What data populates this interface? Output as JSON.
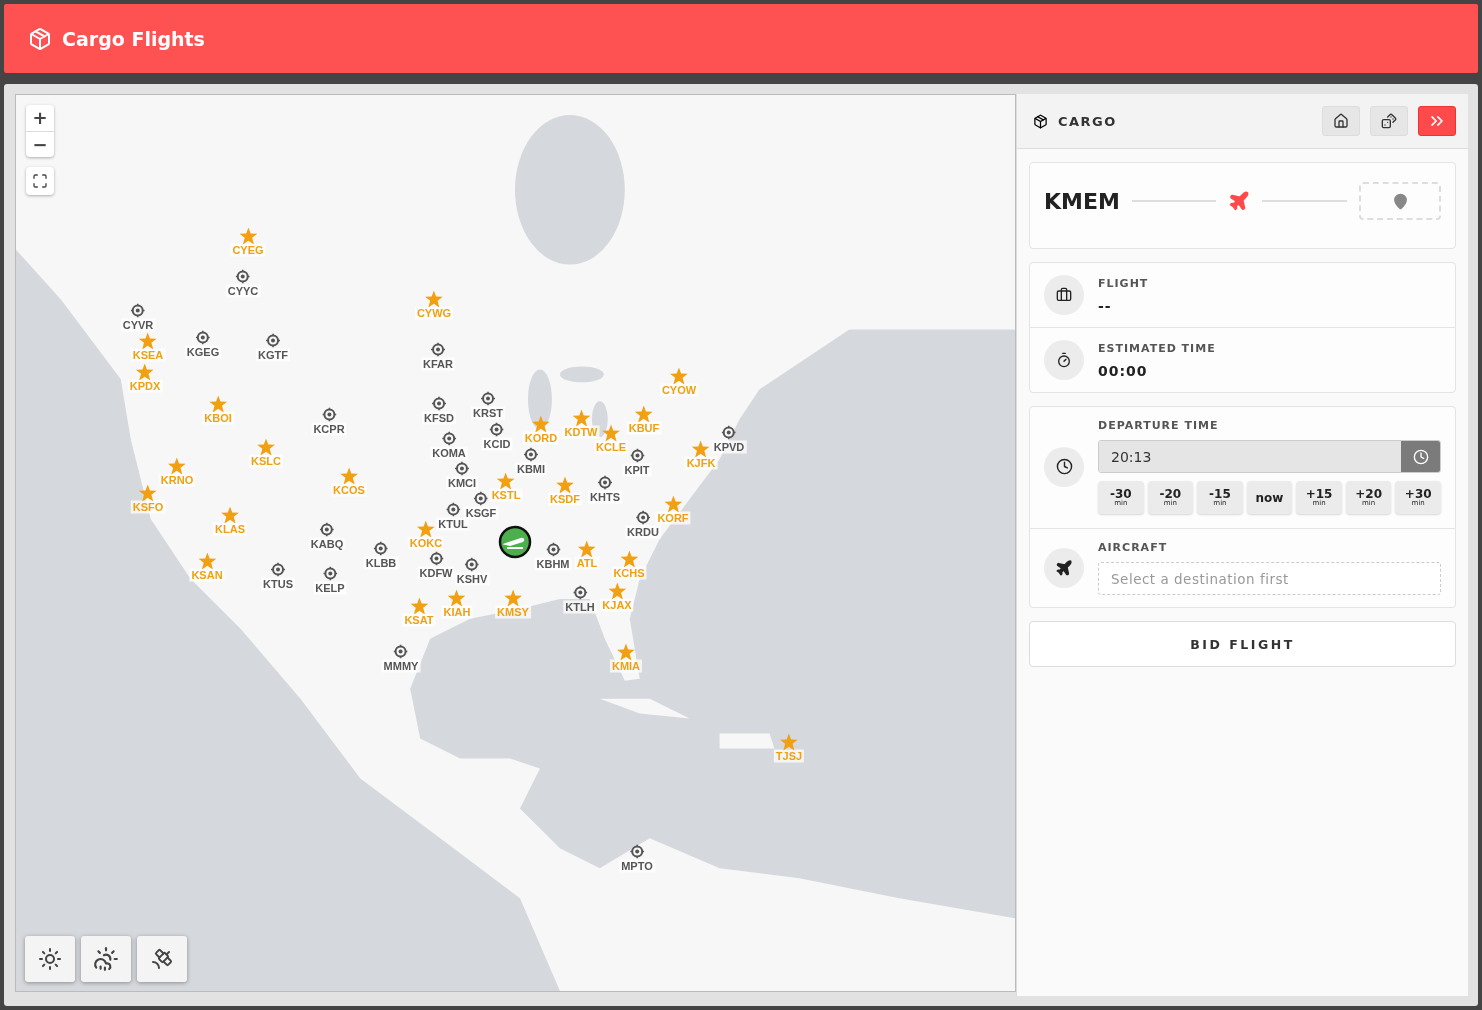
{
  "header": {
    "title": "Cargo Flights"
  },
  "map": {
    "zoom_in": "+",
    "zoom_out": "−",
    "markers": [
      {
        "code": "CYEG",
        "kind": "hub"
      },
      {
        "code": "CYWG",
        "kind": "hub"
      },
      {
        "code": "KSEA",
        "kind": "hub"
      },
      {
        "code": "KPDX",
        "kind": "hub"
      },
      {
        "code": "KBOI",
        "kind": "hub"
      },
      {
        "code": "KSLC",
        "kind": "hub"
      },
      {
        "code": "KRNO",
        "kind": "hub"
      },
      {
        "code": "KCOS",
        "kind": "hub"
      },
      {
        "code": "KSFO",
        "kind": "hub"
      },
      {
        "code": "KLAS",
        "kind": "hub"
      },
      {
        "code": "KSAN",
        "kind": "hub"
      },
      {
        "code": "KOKC",
        "kind": "hub"
      },
      {
        "code": "KSAT",
        "kind": "hub"
      },
      {
        "code": "KIAH",
        "kind": "hub"
      },
      {
        "code": "KMSY",
        "kind": "hub"
      },
      {
        "code": "KSTL",
        "kind": "hub"
      },
      {
        "code": "KORD",
        "kind": "hub"
      },
      {
        "code": "KDTW",
        "kind": "hub"
      },
      {
        "code": "KCLE",
        "kind": "hub"
      },
      {
        "code": "KSDF",
        "kind": "hub"
      },
      {
        "code": "CYOW",
        "kind": "hub"
      },
      {
        "code": "KBUF",
        "kind": "hub"
      },
      {
        "code": "KJFK",
        "kind": "hub"
      },
      {
        "code": "KORF",
        "kind": "hub"
      },
      {
        "code": "ATL",
        "kind": "hub"
      },
      {
        "code": "KCHS",
        "kind": "hub"
      },
      {
        "code": "KJAX",
        "kind": "hub"
      },
      {
        "code": "KMIA",
        "kind": "hub"
      },
      {
        "code": "TJSJ",
        "kind": "hub"
      },
      {
        "code": "CYYC",
        "kind": "airport"
      },
      {
        "code": "CYVR",
        "kind": "airport"
      },
      {
        "code": "KGEG",
        "kind": "airport"
      },
      {
        "code": "KGTF",
        "kind": "airport"
      },
      {
        "code": "KFAR",
        "kind": "airport"
      },
      {
        "code": "KRST",
        "kind": "airport"
      },
      {
        "code": "KFSD",
        "kind": "airport"
      },
      {
        "code": "KCPR",
        "kind": "airport"
      },
      {
        "code": "KCID",
        "kind": "airport"
      },
      {
        "code": "KOMA",
        "kind": "airport"
      },
      {
        "code": "KMCI",
        "kind": "airport"
      },
      {
        "code": "KBMI",
        "kind": "airport"
      },
      {
        "code": "KPIT",
        "kind": "airport"
      },
      {
        "code": "KHTS",
        "kind": "airport"
      },
      {
        "code": "KSGF",
        "kind": "airport"
      },
      {
        "code": "KTUL",
        "kind": "airport"
      },
      {
        "code": "KABQ",
        "kind": "airport"
      },
      {
        "code": "KLBB",
        "kind": "airport"
      },
      {
        "code": "KDFW",
        "kind": "airport"
      },
      {
        "code": "KSHV",
        "kind": "airport"
      },
      {
        "code": "KTUS",
        "kind": "airport"
      },
      {
        "code": "KELP",
        "kind": "airport"
      },
      {
        "code": "KBHM",
        "kind": "airport"
      },
      {
        "code": "KRDU",
        "kind": "airport"
      },
      {
        "code": "KTLH",
        "kind": "airport"
      },
      {
        "code": "KPVD",
        "kind": "airport"
      },
      {
        "code": "MMMY",
        "kind": "airport"
      },
      {
        "code": "MPTO",
        "kind": "airport"
      }
    ]
  },
  "panel": {
    "title": "CARGO",
    "route": {
      "origin": "KMEM"
    },
    "info": [
      {
        "label": "FLIGHT",
        "value": "--",
        "kind": "flight"
      },
      {
        "label": "ESTIMATED TIME",
        "value": "00:00",
        "kind": "time"
      }
    ],
    "departure": {
      "label": "DEPARTURE TIME",
      "value": "20:13",
      "offsets": [
        {
          "label": "-30",
          "unit": "min"
        },
        {
          "label": "-20",
          "unit": "min"
        },
        {
          "label": "-15",
          "unit": "min"
        },
        {
          "label": "now"
        },
        {
          "label": "+15",
          "unit": "min"
        },
        {
          "label": "+20",
          "unit": "min"
        },
        {
          "label": "+30",
          "unit": "min"
        }
      ]
    },
    "aircraft": {
      "label": "AIRCRAFT",
      "placeholder": "Select a destination first"
    },
    "submit": "BID FLIGHT"
  }
}
